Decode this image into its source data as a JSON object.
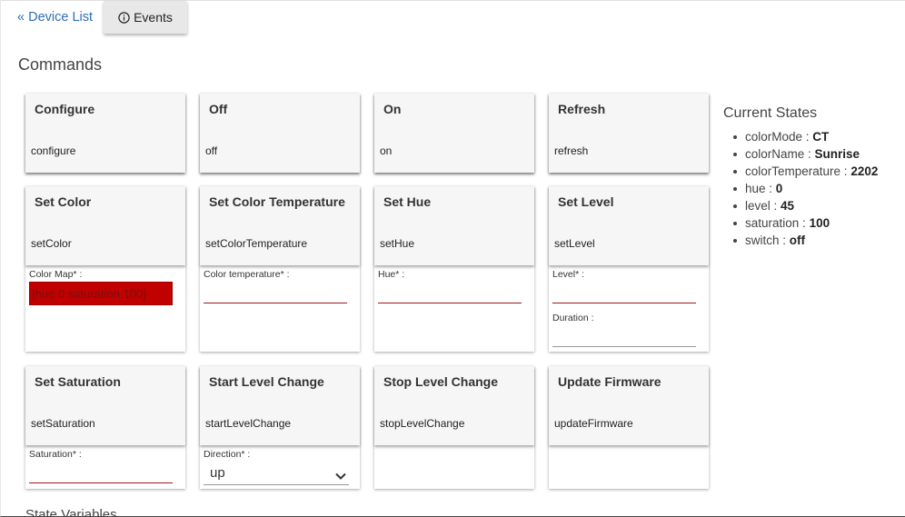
{
  "nav": {
    "back_link": "« Device List",
    "events_button": "Events",
    "events_icon": "info-icon"
  },
  "commands": {
    "title": "Commands",
    "cards": [
      {
        "title": "Configure",
        "name": "configure"
      },
      {
        "title": "Off",
        "name": "off"
      },
      {
        "title": "On",
        "name": "on"
      },
      {
        "title": "Refresh",
        "name": "refresh"
      },
      {
        "title": "Set Color",
        "name": "setColor",
        "fields": [
          {
            "label": "Color Map* :",
            "value": "[hue 0 saturation 100]"
          }
        ]
      },
      {
        "title": "Set Color Temperature",
        "name": "setColorTemperature",
        "fields": [
          {
            "label": "Color temperature* :",
            "value": ""
          }
        ]
      },
      {
        "title": "Set Hue",
        "name": "setHue",
        "fields": [
          {
            "label": "Hue* :",
            "value": ""
          }
        ]
      },
      {
        "title": "Set Level",
        "name": "setLevel",
        "fields": [
          {
            "label": "Level* :",
            "value": ""
          },
          {
            "label": "Duration :",
            "value": ""
          }
        ]
      },
      {
        "title": "Set Saturation",
        "name": "setSaturation",
        "fields": [
          {
            "label": "Saturation* :",
            "value": ""
          }
        ]
      },
      {
        "title": "Start Level Change",
        "name": "startLevelChange",
        "fields": [
          {
            "label": "Direction* :",
            "value": "up"
          }
        ]
      },
      {
        "title": "Stop Level Change",
        "name": "stopLevelChange"
      },
      {
        "title": "Update Firmware",
        "name": "updateFirmware"
      }
    ]
  },
  "current_states": {
    "title": "Current States",
    "items": [
      {
        "key": "colorMode",
        "value": "CT"
      },
      {
        "key": "colorName",
        "value": "Sunrise"
      },
      {
        "key": "colorTemperature",
        "value": "2202"
      },
      {
        "key": "hue",
        "value": "0"
      },
      {
        "key": "level",
        "value": "45"
      },
      {
        "key": "saturation",
        "value": "100"
      },
      {
        "key": "switch",
        "value": "off"
      }
    ]
  },
  "state_variables": {
    "title": "State Variables"
  },
  "colors": {
    "link": "#2e6fb7",
    "input_underline": "#9b1b1b",
    "color_map_fill": "#c10000"
  }
}
